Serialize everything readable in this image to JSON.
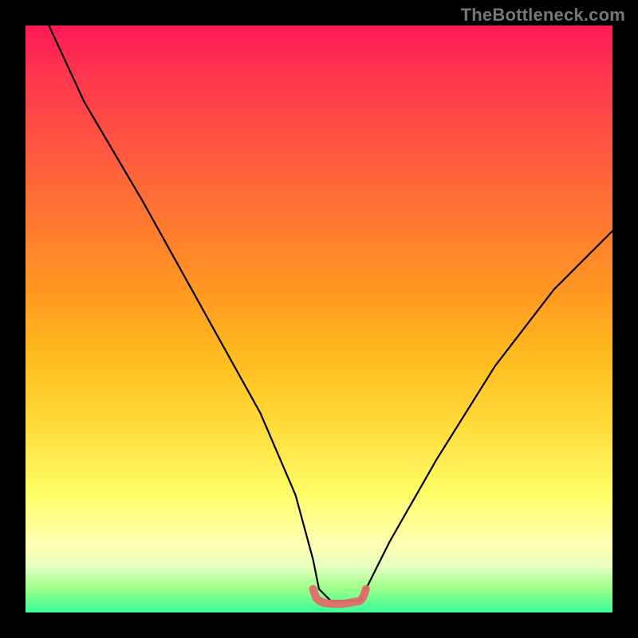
{
  "attribution": "TheBottleneck.com",
  "chart_data": {
    "type": "line",
    "title": "",
    "xlabel": "",
    "ylabel": "",
    "x_range": [
      0,
      100
    ],
    "y_range": [
      0,
      100
    ],
    "series": [
      {
        "name": "bottleneck-curve",
        "color": "#000000",
        "x": [
          4,
          10,
          20,
          30,
          40,
          46,
          49,
          50,
          52,
          54,
          57,
          58,
          60,
          62,
          70,
          80,
          90,
          100
        ],
        "values": [
          100,
          87,
          70,
          52,
          34,
          20,
          9,
          4,
          2,
          2,
          2,
          4,
          8,
          12,
          26,
          42,
          55,
          65
        ]
      },
      {
        "name": "sweet-spot-marker",
        "color": "#e26b6b",
        "x": [
          49,
          49.5,
          50,
          51,
          52,
          53,
          54,
          55,
          56,
          57,
          57.5,
          58
        ],
        "values": [
          4,
          2.5,
          2,
          1.6,
          1.5,
          1.5,
          1.5,
          1.6,
          1.8,
          2,
          2.6,
          4
        ]
      }
    ],
    "gradient_stops": [
      {
        "pos": 0,
        "color": "#ff1a57"
      },
      {
        "pos": 10,
        "color": "#ff3a4d"
      },
      {
        "pos": 22,
        "color": "#ff5a3f"
      },
      {
        "pos": 34,
        "color": "#ff7a30"
      },
      {
        "pos": 46,
        "color": "#ff9a20"
      },
      {
        "pos": 58,
        "color": "#ffc020"
      },
      {
        "pos": 70,
        "color": "#ffe040"
      },
      {
        "pos": 80,
        "color": "#ffff6a"
      },
      {
        "pos": 88,
        "color": "#ffffb0"
      },
      {
        "pos": 92,
        "color": "#e8ffc0"
      },
      {
        "pos": 96,
        "color": "#99ff8a"
      },
      {
        "pos": 100,
        "color": "#3aff99"
      }
    ]
  }
}
